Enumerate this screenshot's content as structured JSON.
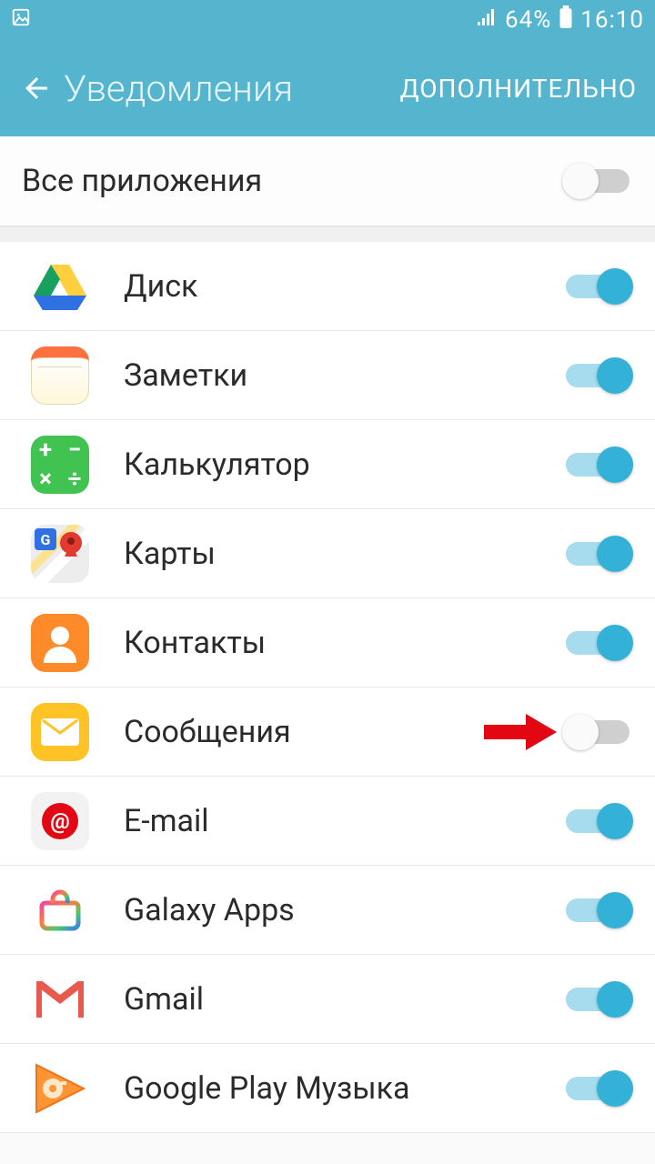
{
  "status": {
    "battery_pct": "64%",
    "time": "16:10"
  },
  "header": {
    "title": "Уведомления",
    "action": "ДОПОЛНИТЕЛЬНО"
  },
  "all_apps": {
    "label": "Все приложения",
    "enabled": false
  },
  "apps": [
    {
      "id": "drive",
      "label": "Диск",
      "enabled": true,
      "icon": "drive-icon"
    },
    {
      "id": "notes",
      "label": "Заметки",
      "enabled": true,
      "icon": "notes-icon"
    },
    {
      "id": "calc",
      "label": "Калькулятор",
      "enabled": true,
      "icon": "calculator-icon"
    },
    {
      "id": "maps",
      "label": "Карты",
      "enabled": true,
      "icon": "maps-icon"
    },
    {
      "id": "contacts",
      "label": "Контакты",
      "enabled": true,
      "icon": "contacts-icon"
    },
    {
      "id": "messages",
      "label": "Сообщения",
      "enabled": false,
      "icon": "messages-icon",
      "annotation_arrow": true
    },
    {
      "id": "email",
      "label": "E-mail",
      "enabled": true,
      "icon": "email-icon"
    },
    {
      "id": "galaxyapps",
      "label": "Galaxy Apps",
      "enabled": true,
      "icon": "galaxy-apps-icon"
    },
    {
      "id": "gmail",
      "label": "Gmail",
      "enabled": true,
      "icon": "gmail-icon"
    },
    {
      "id": "playmusic",
      "label": "Google Play Музыка",
      "enabled": true,
      "icon": "play-music-icon"
    }
  ]
}
